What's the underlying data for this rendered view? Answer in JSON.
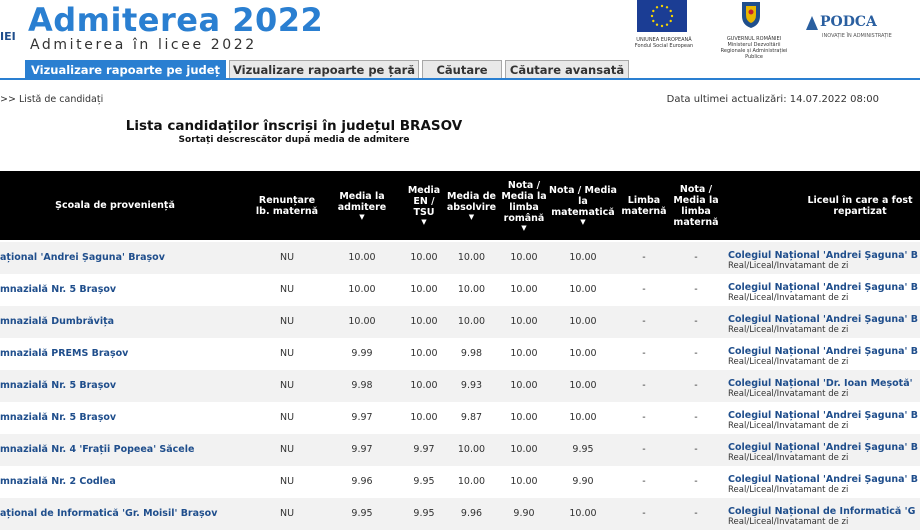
{
  "header": {
    "left_stub": "IEI",
    "title": "Admiterea 2022",
    "subtitle": "Admiterea în licee 2022",
    "eu_caption": "UNIUNEA EUROPEANĂ Fondul Social European",
    "gov_caption": "GUVERNUL ROMÂNIEI Ministerul Dezvoltării Regionale și Administrației Publice",
    "podca_label": "PODCA",
    "podca_tagline": "INOVAȚIE ÎN ADMINISTRAȚIE"
  },
  "tabs": [
    {
      "label": "Vizualizare rapoarte pe județ",
      "active": true
    },
    {
      "label": "Vizualizare rapoarte pe țară",
      "active": false
    },
    {
      "label": "Căutare",
      "active": false
    },
    {
      "label": "Căutare avansată",
      "active": false
    }
  ],
  "breadcrumb": ">> Listă de candidați",
  "last_update": "Data ultimei actualizări: 14.07.2022 08:00",
  "list_title": "Lista candidaților înscriși în județul BRASOV",
  "list_subtitle": "Sortați descrescător după media de admitere",
  "columns": {
    "school": "Școala de proveniență",
    "renuntare": "Renunțare lb. maternă",
    "media_admitere": "Media la admitere",
    "media_en": "Media EN / TSU",
    "media_absolvire": "Media de absolvire",
    "nota_romana": "Nota / Media la limba română",
    "nota_mate": "Nota / Media la matematică",
    "limba_materna": "Limba maternă",
    "nota_materna": "Nota / Media la limba maternă",
    "liceu": "Liceul în care a fost repartizat"
  },
  "rows": [
    {
      "school": "ațional 'Andrei Șaguna' Brașov",
      "renuntare": "NU",
      "admitere": "10.00",
      "en": "10.00",
      "absolvire": "10.00",
      "romana": "10.00",
      "mate": "10.00",
      "limba": "-",
      "nota_lm": "-",
      "liceu": "Colegiul Național 'Andrei Șaguna' B",
      "profil": "Real/Liceal/Invatamant de zi"
    },
    {
      "school": "mnazială Nr. 5 Brașov",
      "renuntare": "NU",
      "admitere": "10.00",
      "en": "10.00",
      "absolvire": "10.00",
      "romana": "10.00",
      "mate": "10.00",
      "limba": "-",
      "nota_lm": "-",
      "liceu": "Colegiul Național 'Andrei Șaguna' B",
      "profil": "Real/Liceal/Invatamant de zi"
    },
    {
      "school": "mnazială Dumbrăvița",
      "renuntare": "NU",
      "admitere": "10.00",
      "en": "10.00",
      "absolvire": "10.00",
      "romana": "10.00",
      "mate": "10.00",
      "limba": "-",
      "nota_lm": "-",
      "liceu": "Colegiul Național 'Andrei Șaguna' B",
      "profil": "Real/Liceal/Invatamant de zi"
    },
    {
      "school": "mnazială PREMS Brașov",
      "renuntare": "NU",
      "admitere": "9.99",
      "en": "10.00",
      "absolvire": "9.98",
      "romana": "10.00",
      "mate": "10.00",
      "limba": "-",
      "nota_lm": "-",
      "liceu": "Colegiul Național 'Andrei Șaguna' B",
      "profil": "Real/Liceal/Invatamant de zi"
    },
    {
      "school": "mnazială Nr. 5 Brașov",
      "renuntare": "NU",
      "admitere": "9.98",
      "en": "10.00",
      "absolvire": "9.93",
      "romana": "10.00",
      "mate": "10.00",
      "limba": "-",
      "nota_lm": "-",
      "liceu": "Colegiul Național 'Dr. Ioan Meșotă'",
      "profil": "Real/Liceal/Invatamant de zi"
    },
    {
      "school": "mnazială Nr. 5 Brașov",
      "renuntare": "NU",
      "admitere": "9.97",
      "en": "10.00",
      "absolvire": "9.87",
      "romana": "10.00",
      "mate": "10.00",
      "limba": "-",
      "nota_lm": "-",
      "liceu": "Colegiul Național 'Andrei Șaguna' B",
      "profil": "Real/Liceal/Invatamant de zi"
    },
    {
      "school": "mnazială Nr. 4 'Frații Popeea' Săcele",
      "renuntare": "NU",
      "admitere": "9.97",
      "en": "9.97",
      "absolvire": "10.00",
      "romana": "10.00",
      "mate": "9.95",
      "limba": "-",
      "nota_lm": "-",
      "liceu": "Colegiul Național 'Andrei Șaguna' B",
      "profil": "Real/Liceal/Invatamant de zi"
    },
    {
      "school": "mnazială Nr. 2 Codlea",
      "renuntare": "NU",
      "admitere": "9.96",
      "en": "9.95",
      "absolvire": "10.00",
      "romana": "10.00",
      "mate": "9.90",
      "limba": "-",
      "nota_lm": "-",
      "liceu": "Colegiul Național 'Andrei Șaguna' B",
      "profil": "Real/Liceal/Invatamant de zi"
    },
    {
      "school": "ațional de Informatică 'Gr. Moisil' Brașov",
      "renuntare": "NU",
      "admitere": "9.95",
      "en": "9.95",
      "absolvire": "9.96",
      "romana": "9.90",
      "mate": "10.00",
      "limba": "-",
      "nota_lm": "-",
      "liceu": "Colegiul Național de Informatică 'G",
      "profil": "Real/Liceal/Invatamant de zi"
    }
  ]
}
